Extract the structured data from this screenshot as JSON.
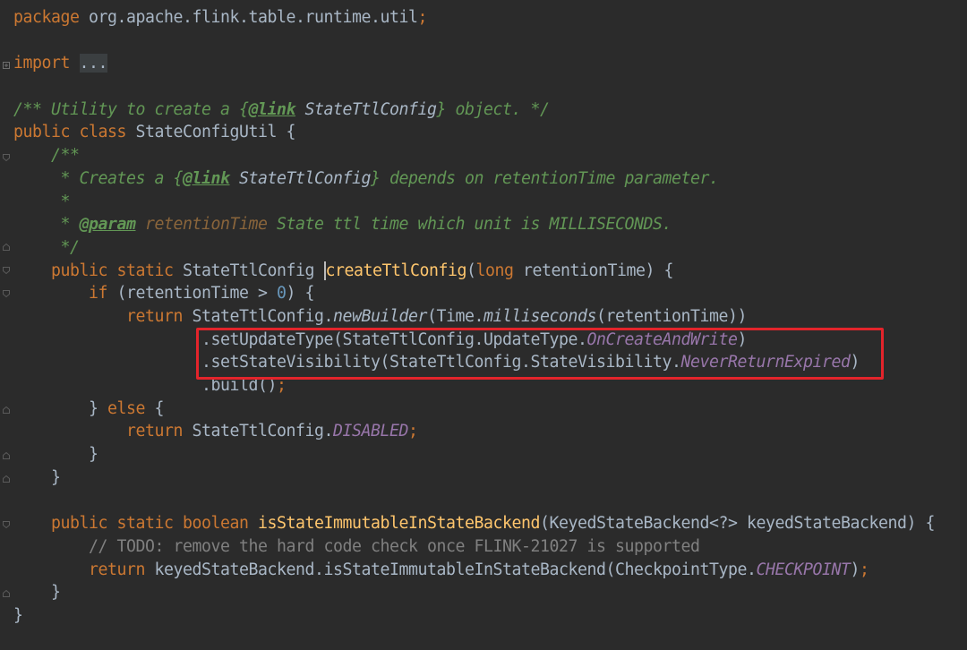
{
  "editor": {
    "colors": {
      "background": "#2b2b2b",
      "keyword": "#cc7832",
      "plain": "#a9b7c6",
      "comment": "#629755",
      "line_comment": "#808080",
      "method_declaration": "#ffc66d",
      "field": "#9876aa",
      "number": "#6897bb",
      "highlight_box": "#e3242b"
    },
    "lines": [
      [
        [
          "keyword",
          "package"
        ],
        [
          "plain",
          " org.apache.flink.table.runtime.util"
        ],
        [
          "punct",
          ";"
        ]
      ],
      [],
      [
        [
          "keyword",
          "import"
        ],
        [
          "plain",
          " "
        ],
        [
          "folded",
          "..."
        ]
      ],
      [],
      [
        [
          "comment",
          "/** Utility to create a {"
        ],
        [
          "doc-tag",
          "@link"
        ],
        [
          "doc-ref",
          " StateTtlConfig"
        ],
        [
          "comment",
          "} object. */"
        ]
      ],
      [
        [
          "keyword",
          "public class"
        ],
        [
          "plain",
          " StateConfigUtil {"
        ]
      ],
      [
        [
          "comment",
          "    /**"
        ]
      ],
      [
        [
          "comment",
          "     * Creates a {"
        ],
        [
          "doc-tag",
          "@link"
        ],
        [
          "doc-ref",
          " StateTtlConfig"
        ],
        [
          "comment",
          "} depends on retentionTime parameter."
        ]
      ],
      [
        [
          "comment",
          "     *"
        ]
      ],
      [
        [
          "comment",
          "     * "
        ],
        [
          "doc-tag",
          "@param"
        ],
        [
          "doc-param",
          " retentionTime"
        ],
        [
          "comment",
          " State ttl time which unit is MILLISECONDS."
        ]
      ],
      [
        [
          "comment",
          "     */"
        ]
      ],
      [
        [
          "keyword",
          "    public static"
        ],
        [
          "plain",
          " StateTtlConfig "
        ],
        [
          "caret",
          ""
        ],
        [
          "method-decl",
          "createTtlConfig"
        ],
        [
          "plain",
          "("
        ],
        [
          "keyword",
          "long"
        ],
        [
          "plain",
          " retentionTime) {"
        ]
      ],
      [
        [
          "keyword",
          "        if"
        ],
        [
          "plain",
          " (retentionTime > "
        ],
        [
          "number",
          "0"
        ],
        [
          "plain",
          ") {"
        ]
      ],
      [
        [
          "keyword",
          "            return"
        ],
        [
          "plain",
          " StateTtlConfig."
        ],
        [
          "static-method",
          "newBuilder"
        ],
        [
          "plain",
          "(Time."
        ],
        [
          "static-method",
          "milliseconds"
        ],
        [
          "plain",
          "(retentionTime))"
        ]
      ],
      [
        [
          "plain",
          "                    .setUpdateType(StateTtlConfig.UpdateType."
        ],
        [
          "field",
          "OnCreateAndWrite"
        ],
        [
          "plain",
          ")"
        ]
      ],
      [
        [
          "plain",
          "                    .setStateVisibility(StateTtlConfig.StateVisibility."
        ],
        [
          "field",
          "NeverReturnExpired"
        ],
        [
          "plain",
          ")"
        ]
      ],
      [
        [
          "plain",
          "                    .build()"
        ],
        [
          "punct",
          ";"
        ]
      ],
      [
        [
          "plain",
          "        } "
        ],
        [
          "keyword",
          "else"
        ],
        [
          "plain",
          " {"
        ]
      ],
      [
        [
          "keyword",
          "            return"
        ],
        [
          "plain",
          " StateTtlConfig."
        ],
        [
          "field",
          "DISABLED"
        ],
        [
          "punct",
          ";"
        ]
      ],
      [
        [
          "plain",
          "        }"
        ]
      ],
      [
        [
          "plain",
          "    }"
        ]
      ],
      [],
      [
        [
          "keyword",
          "    public static boolean"
        ],
        [
          "plain",
          " "
        ],
        [
          "method-decl",
          "isStateImmutableInStateBackend"
        ],
        [
          "plain",
          "(KeyedStateBackend<?> keyedStateBackend) {"
        ]
      ],
      [
        [
          "line-comment",
          "        // TODO: remove the hard code check once FLINK-21027 is supported"
        ]
      ],
      [
        [
          "keyword",
          "        return"
        ],
        [
          "plain",
          " keyedStateBackend.isStateImmutableInStateBackend(CheckpointType."
        ],
        [
          "field",
          "CHECKPOINT"
        ],
        [
          "plain",
          ")"
        ],
        [
          "punct",
          ";"
        ]
      ],
      [
        [
          "plain",
          "    }"
        ]
      ],
      [
        [
          "plain",
          "}"
        ]
      ]
    ]
  }
}
